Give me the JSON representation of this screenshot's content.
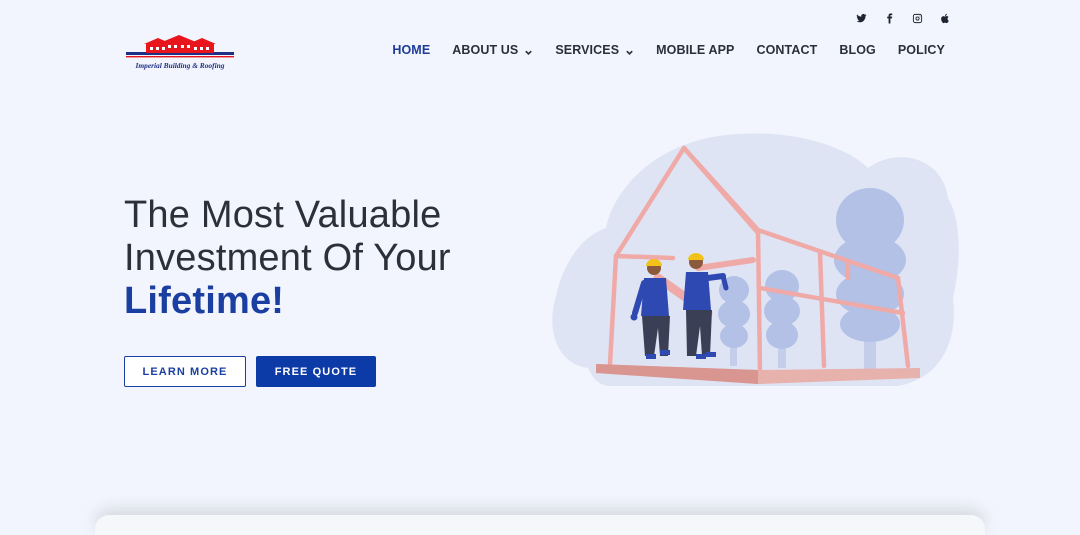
{
  "brand": {
    "name": "Imperial Building & Roofing",
    "colors": {
      "primary": "#0c3aa6",
      "logo_red": "#e8151d"
    }
  },
  "social": [
    {
      "icon": "twitter-icon"
    },
    {
      "icon": "facebook-icon"
    },
    {
      "icon": "instagram-icon"
    },
    {
      "icon": "apple-icon"
    }
  ],
  "nav": {
    "home": "HOME",
    "about": "ABOUT US",
    "services": "SERVICES",
    "mobile_app": "MOBILE APP",
    "contact": "CONTACT",
    "blog": "BLOG",
    "policy": "POLICY"
  },
  "hero": {
    "line1": "The Most Valuable",
    "line2": "Investment Of Your",
    "accent": "Lifetime!",
    "learn_more": "LEARN MORE",
    "free_quote": "FREE QUOTE"
  }
}
